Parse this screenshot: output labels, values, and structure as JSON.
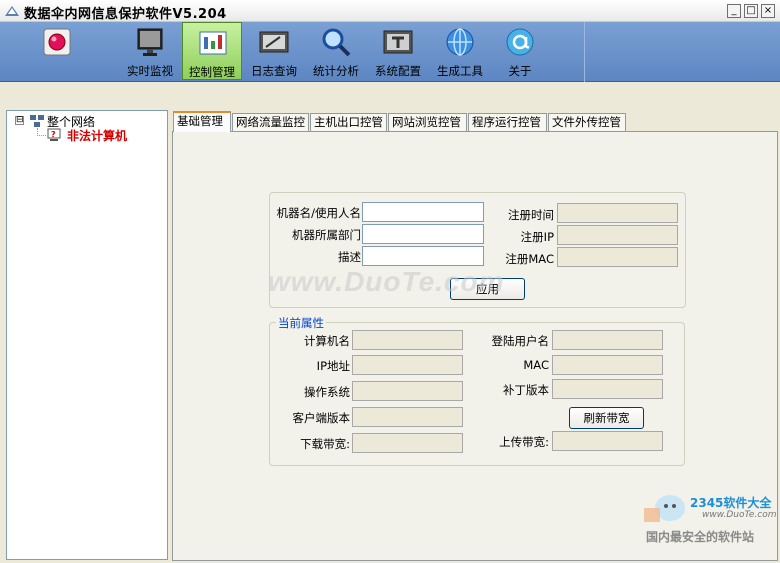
{
  "window": {
    "title": "数据伞内网信息保护软件V5.204",
    "minimize": "_",
    "maximize": "□",
    "close": "×"
  },
  "toolbar": {
    "items": [
      {
        "label": "",
        "icon": "record-icon"
      },
      {
        "label": "实时监视",
        "icon": "monitor-icon"
      },
      {
        "label": "控制管理",
        "icon": "control-panel-icon",
        "active": true
      },
      {
        "label": "日志查询",
        "icon": "log-icon"
      },
      {
        "label": "统计分析",
        "icon": "magnifier-icon"
      },
      {
        "label": "系统配置",
        "icon": "config-icon"
      },
      {
        "label": "生成工具",
        "icon": "globe-icon"
      },
      {
        "label": "关于",
        "icon": "about-icon"
      }
    ]
  },
  "tree": {
    "expander": "⊟",
    "root": "整个网络",
    "child": "非法计算机"
  },
  "tabs": [
    "基础管理",
    "网络流量监控",
    "主机出口控管",
    "网站浏览控管",
    "程序运行控管",
    "文件外传控管"
  ],
  "register": {
    "machine_user_label": "机器名/使用人名",
    "department_label": "机器所属部门",
    "description_label": "描述",
    "reg_time_label": "注册时间",
    "reg_ip_label": "注册IP",
    "reg_mac_label": "注册MAC",
    "apply_button": "应用"
  },
  "current": {
    "legend": "当前属性",
    "computer_name": "计算机名",
    "ip": "IP地址",
    "os": "操作系统",
    "client_version": "客户端版本",
    "download_bw": "下载带宽:",
    "login_user": "登陆用户名",
    "mac": "MAC",
    "patch_version": "补丁版本",
    "refresh_button": "刷新带宽",
    "upload_bw": "上传带宽:"
  },
  "watermarks": {
    "duote": "www.DuoTe.com",
    "brand": "2345软件大全",
    "site": "www.DuoTe.com",
    "slogan": "国内最安全的软件站"
  }
}
